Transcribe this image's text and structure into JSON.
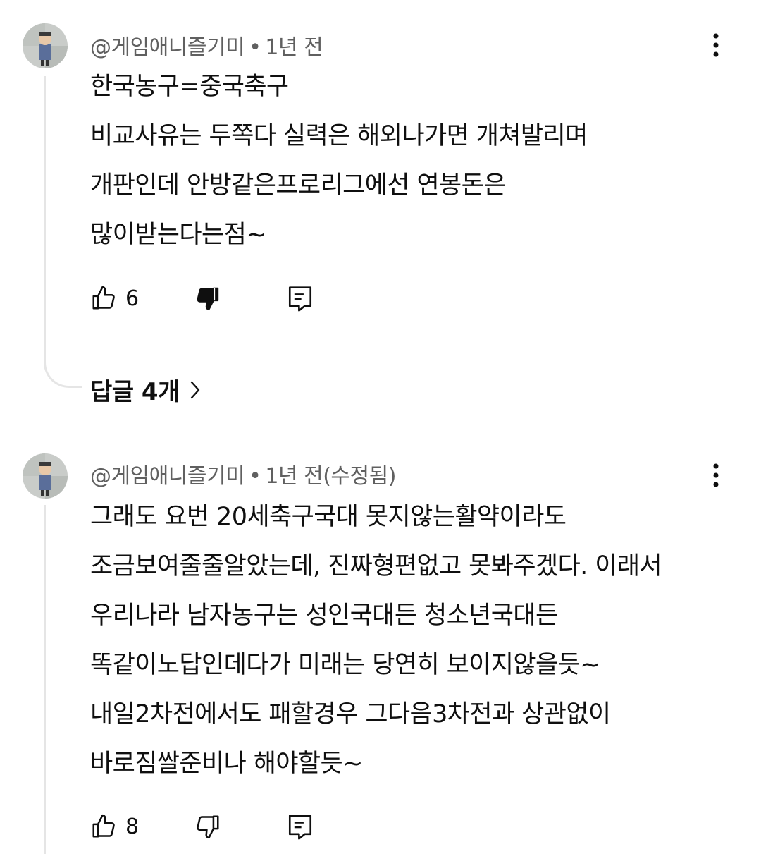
{
  "comments": [
    {
      "handle": "@게임애니즐기미",
      "separator": "•",
      "time": "1년 전",
      "lines": [
        "한국농구=중국축구",
        "비교사유는 두쪽다 실력은 해외나가면 개쳐발리며",
        "개판인데 안방같은프로리그에선 연봉돈은",
        "많이받는다는점~"
      ],
      "likes": "6",
      "dislike_active": true,
      "replies_label": "답글 4개"
    },
    {
      "handle": "@게임애니즐기미",
      "separator": "•",
      "time": "1년 전(수정됨)",
      "lines": [
        "그래도 요번 20세축구국대 못지않는활약이라도",
        "조금보여줄줄알았는데, 진짜형편없고 못봐주겠다. 이래서",
        "우리나라 남자농구는 성인국대든 청소년국대든",
        "똑같이노답인데다가 미래는 당연히 보이지않을듯~",
        "내일2차전에서도 패할경우 그다음3차전과 상관없이",
        "바로짐쌀준비나 해야할듯~"
      ],
      "likes": "8",
      "dislike_active": false
    }
  ],
  "icons": {
    "avatar": "user-avatar",
    "more": "more-vertical-icon",
    "like": "thumbs-up-icon",
    "dislike": "thumbs-down-icon",
    "reply": "reply-comment-icon",
    "chevron": "chevron-right-icon"
  },
  "colors": {
    "text": "#0f0f0f",
    "meta": "#606060",
    "thread_line": "#e5e5e5"
  }
}
